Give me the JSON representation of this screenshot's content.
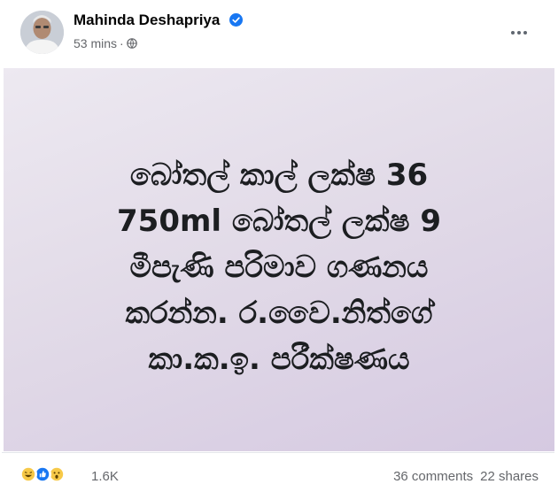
{
  "post": {
    "author": "Mahinda Deshapriya",
    "time": "53 mins",
    "separator": "·",
    "privacy_icon": "globe-icon",
    "verified_icon": "verified-badge-icon",
    "more_icon": "more-options-icon",
    "image_text": [
      "බෝතල් කාල් ලක්ෂ 36",
      "750ml බෝතල් ලක්ෂ 9",
      "මීපැණි පරිමාව ගණනය",
      "කරන්න. ර.වෛ.නිත්ගේ",
      "කා.ක.ඉ. පරීක්ෂණය"
    ]
  },
  "footer": {
    "reactions": [
      "haha-icon",
      "like-icon",
      "wow-icon"
    ],
    "reaction_count": "1.6K",
    "comments": "36 comments",
    "shares": "22 shares"
  },
  "colors": {
    "accent": "#1877f2",
    "text_secondary": "#65676b",
    "background_gradient_start": "#ede9f1",
    "background_gradient_end": "#d5c9e1"
  }
}
